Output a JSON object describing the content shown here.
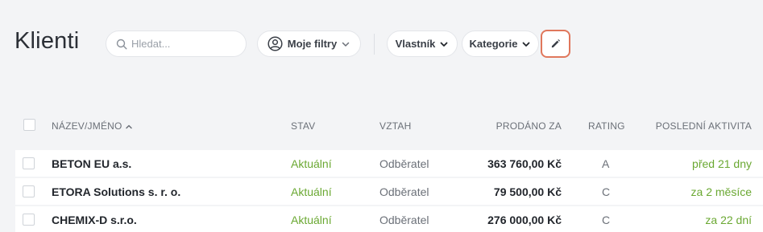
{
  "page": {
    "title": "Klienti"
  },
  "toolbar": {
    "search_placeholder": "Hledat...",
    "my_filters_label": "Moje filtry",
    "owner_label": "Vlastník",
    "category_label": "Kategorie"
  },
  "table": {
    "headers": {
      "name": "NÁZEV/JMÉNO",
      "sort_indicator": "^",
      "state": "STAV",
      "relation": "VZTAH",
      "sold": "PRODÁNO ZA",
      "rating": "RATING",
      "last_activity": "POSLEDNÍ AKTIVITA"
    },
    "rows": [
      {
        "name": "BETON EU a.s.",
        "state": "Aktuální",
        "relation": "Odběratel",
        "sold": "363 760,00 Kč",
        "rating": "A",
        "last_activity": "před 21 dny"
      },
      {
        "name": "ETORA Solutions s. r. o.",
        "state": "Aktuální",
        "relation": "Odběratel",
        "sold": "79 500,00 Kč",
        "rating": "C",
        "last_activity": "za 2 měsíce"
      },
      {
        "name": "CHEMIX-D s.r.o.",
        "state": "Aktuální",
        "relation": "Odběratel",
        "sold": "276 000,00 Kč",
        "rating": "C",
        "last_activity": "za 22 dní"
      }
    ]
  },
  "colors": {
    "accent_green": "#6aa832",
    "edit_outline": "#e0775c"
  },
  "icons": [
    "search-icon",
    "user-circle-icon",
    "chevron-down-icon",
    "pencil-icon",
    "sort-up-icon"
  ]
}
